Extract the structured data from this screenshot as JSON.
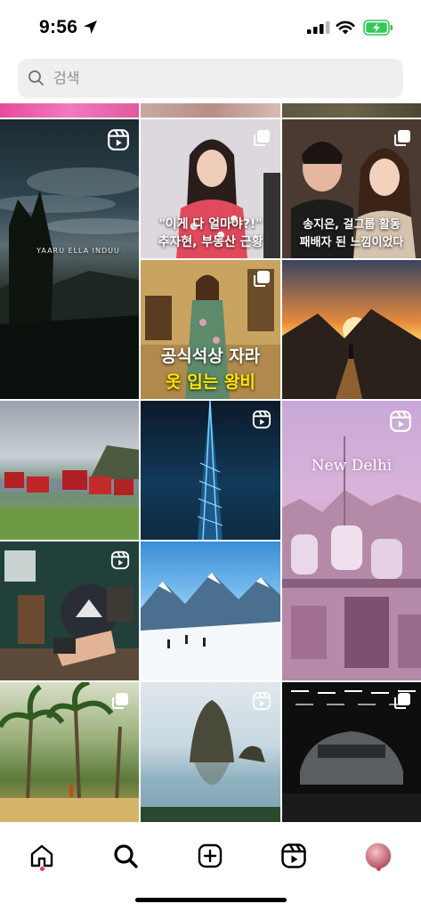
{
  "status": {
    "time": "9:56"
  },
  "search": {
    "placeholder": "검색",
    "value": ""
  },
  "tiles": {
    "t2": {
      "caption_line1": "\"이게 다 얼마야?!\"",
      "caption_line2": "추자현, 부동산 근황"
    },
    "t3": {
      "caption_line1": "송지은, 걸그룹 활동",
      "caption_line2": "패배자 된 느낌이었다"
    },
    "t1": {
      "watermark": "YAARU ELLA INDUU"
    },
    "t5": {
      "caption_line1": "공식석상 자라",
      "caption_line2": "옷 입는 왕비"
    },
    "t9": {
      "overlay_text": "New Delhi"
    }
  },
  "icons": {
    "reel": "reel-icon",
    "carousel": "carousel-icon",
    "home": "home-icon",
    "search": "search-icon",
    "add": "add-post-icon",
    "reels_tab": "reels-tab-icon",
    "profile": "profile-avatar"
  },
  "colors": {
    "notification_dot": "#ff2d55",
    "battery": "#34c759"
  }
}
